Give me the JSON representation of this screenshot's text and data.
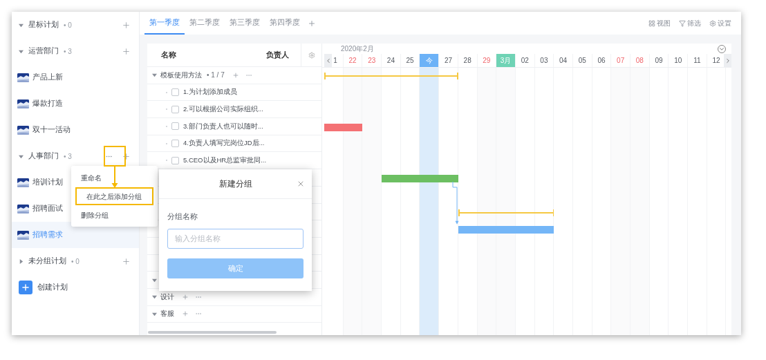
{
  "sidebar": {
    "groups": [
      {
        "name": "星标计划",
        "count": "• 0",
        "expanded": true,
        "hovered": false
      },
      {
        "name": "运营部门",
        "count": "• 3",
        "expanded": true,
        "hovered": false,
        "plans": [
          {
            "name": "产品上新",
            "selected": false
          },
          {
            "name": "爆款打造",
            "selected": false
          },
          {
            "name": "双十一活动",
            "selected": false
          }
        ]
      },
      {
        "name": "人事部门",
        "count": "• 3",
        "expanded": true,
        "hovered": true,
        "plans": [
          {
            "name": "培训计划",
            "selected": false
          },
          {
            "name": "招聘面试",
            "selected": false
          },
          {
            "name": "招聘需求",
            "selected": true
          }
        ]
      },
      {
        "name": "未分组计划",
        "count": "• 0",
        "expanded": false,
        "hovered": false
      }
    ],
    "create_button": {
      "label": "创建计划"
    }
  },
  "tabs": [
    {
      "label": "第一季度",
      "selected": true
    },
    {
      "label": "第二季度",
      "selected": false
    },
    {
      "label": "第三季度",
      "selected": false
    },
    {
      "label": "第四季度",
      "selected": false
    }
  ],
  "toolbar": [
    {
      "kind": "view",
      "label": "视图"
    },
    {
      "kind": "filter",
      "label": "筛选"
    },
    {
      "kind": "settings",
      "label": "设置"
    }
  ],
  "table": {
    "columns": [
      "名称",
      "负责人"
    ],
    "rows": [
      {
        "kind": "group",
        "name": "模板使用方法",
        "task_count": "• 1 / 7",
        "bar": {
          "kind": "span",
          "color": "#f5c842"
        }
      },
      {
        "kind": "task",
        "name": "1.为计划添加成员",
        "checked": false
      },
      {
        "kind": "task",
        "name": "2.可以根据公司实际组织...",
        "checked": false
      },
      {
        "kind": "task",
        "name": "3.部门负责人也可以随时...",
        "checked": false,
        "bar": {
          "kind": "bar",
          "color": "#f47174"
        }
      },
      {
        "kind": "task",
        "name": "4.负责人填写完岗位JD后...",
        "checked": false
      },
      {
        "kind": "task",
        "name": "5.CEO以及HR总监审批同...",
        "checked": false
      },
      {
        "kind": "covered",
        "bar": {
          "kind": "bar",
          "color": "#6cbf62"
        }
      },
      {
        "kind": "covered"
      },
      {
        "kind": "covered",
        "bar": {
          "kind": "span",
          "color": "#f5c842"
        }
      },
      {
        "kind": "covered",
        "bar": {
          "kind": "bar",
          "color": "#74b6f7",
          "linked": true
        }
      },
      {
        "kind": "covered"
      },
      {
        "kind": "covered"
      },
      {
        "kind": "covered_group"
      },
      {
        "kind": "group",
        "name": "设计"
      },
      {
        "kind": "group",
        "name": "客服"
      }
    ]
  },
  "gantt": {
    "month": "2020年2月",
    "days": [
      {
        "label": "1",
        "kind": "normal"
      },
      {
        "label": "22",
        "kind": "weekend"
      },
      {
        "label": "23",
        "kind": "weekend"
      },
      {
        "label": "24",
        "kind": "normal"
      },
      {
        "label": "25",
        "kind": "normal"
      },
      {
        "label": "今",
        "kind": "today"
      },
      {
        "label": "27",
        "kind": "normal"
      },
      {
        "label": "28",
        "kind": "normal"
      },
      {
        "label": "29",
        "kind": "weekend"
      },
      {
        "label": "3月",
        "kind": "month"
      },
      {
        "label": "02",
        "kind": "normal"
      },
      {
        "label": "03",
        "kind": "normal"
      },
      {
        "label": "04",
        "kind": "normal"
      },
      {
        "label": "05",
        "kind": "normal"
      },
      {
        "label": "06",
        "kind": "normal"
      },
      {
        "label": "07",
        "kind": "weekend"
      },
      {
        "label": "08",
        "kind": "weekend"
      },
      {
        "label": "09",
        "kind": "normal"
      },
      {
        "label": "10",
        "kind": "normal"
      },
      {
        "label": "11",
        "kind": "normal"
      },
      {
        "label": "12",
        "kind": "normal"
      }
    ]
  },
  "context_menu": {
    "items": [
      {
        "label": "重命名",
        "selected": false
      },
      {
        "label": "在此之后添加分组",
        "selected": true
      },
      {
        "label": "删除分组",
        "selected": false
      }
    ]
  },
  "dialog": {
    "title": "新建分组",
    "field_label": "分组名称",
    "placeholder": "输入分组名称",
    "confirm": "确定"
  }
}
